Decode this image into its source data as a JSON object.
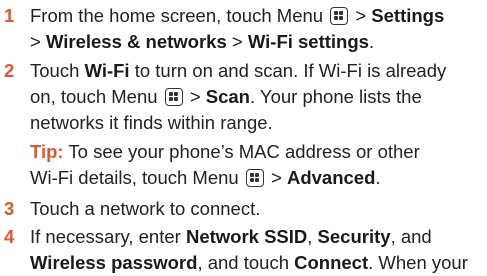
{
  "accent_color": "#e4572e",
  "steps": [
    {
      "number": "1",
      "lines": [
        [
          "From the home screen, touch Menu",
          "menu-icon",
          "> ",
          "Settings"
        ],
        [
          "> ",
          "Wireless & networks",
          " > ",
          "Wi-Fi settings",
          "."
        ]
      ]
    },
    {
      "number": "2",
      "lines": [
        [
          "Touch ",
          "Wi-Fi",
          " to turn on and scan. If Wi-Fi is already"
        ],
        [
          "on, touch Menu",
          "menu-icon",
          "> ",
          "Scan",
          ". Your phone lists the"
        ],
        [
          "networks it finds within range."
        ]
      ]
    },
    {
      "number": "3",
      "lines": [
        [
          "Touch a network to connect."
        ]
      ]
    },
    {
      "number": "4",
      "lines": [
        [
          "If necessary, enter ",
          "Network SSID",
          ", ",
          "Security",
          ", and"
        ],
        [
          "Wireless password",
          ", and touch ",
          "Connect",
          ". When your"
        ]
      ]
    }
  ],
  "tip": {
    "label": "Tip:",
    "lines": [
      [
        " To see your phone’s MAC address or other"
      ],
      [
        "Wi-Fi details, touch Menu",
        "menu-icon",
        "> ",
        "Advanced",
        "."
      ]
    ]
  }
}
